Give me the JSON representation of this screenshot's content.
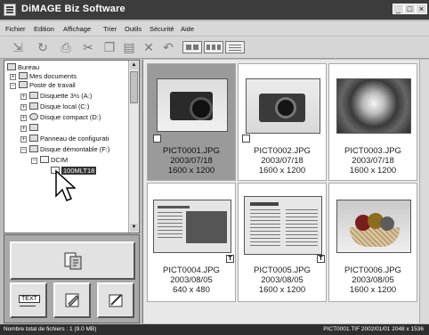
{
  "window": {
    "title": "DiMAGE Biz Software"
  },
  "menu": [
    "Fichier",
    "Edition",
    "Affichage",
    "Trier",
    "Outils",
    "Sécurité",
    "Aide"
  ],
  "toolbar": {
    "icons": [
      "import-icon",
      "rotate-icon",
      "print-icon",
      "cut-icon",
      "copy-icon",
      "paste-icon",
      "delete-icon",
      "undo-icon",
      "view-large-icon",
      "view-medium-icon",
      "view-list-icon"
    ]
  },
  "tree": {
    "items": [
      "Bureau",
      "Mes documents",
      "Poste de travail",
      "Disquette 3½ (A:)",
      "Disque local (C:)",
      "Disque compact (D:)",
      "",
      "Panneau de configurati",
      "Disque démontable (F:)",
      "DCIM",
      "100MLT18"
    ]
  },
  "thumbnails": [
    {
      "name": "PICT0001.JPG",
      "date": "2003/07/18",
      "size": "1600 x 1200",
      "selected": true
    },
    {
      "name": "PICT0002.JPG",
      "date": "2003/07/18",
      "size": "1600 x 1200"
    },
    {
      "name": "PICT0003.JPG",
      "date": "2003/07/18",
      "size": "1600 x 1200"
    },
    {
      "name": "PICT0004.JPG",
      "date": "2003/08/05",
      "size": "640 x 480"
    },
    {
      "name": "PICT0005.JPG",
      "date": "2003/08/05",
      "size": "1600 x 1200"
    },
    {
      "name": "PICT0006.JPG",
      "date": "2003/08/05",
      "size": "1600 x 1200"
    }
  ],
  "panel": {
    "text_button": "TEXT"
  },
  "status": {
    "left": "Nombre total de fichiers : 1 (9.0 MB)",
    "right": "PICT0001.TIF 2002/01/01 2048 x 1536"
  }
}
